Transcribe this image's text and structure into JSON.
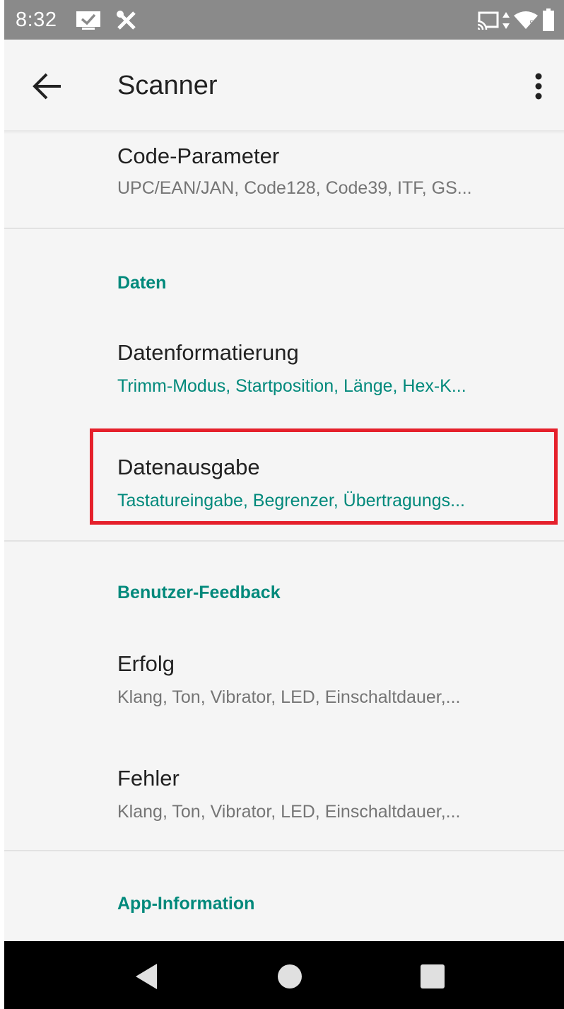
{
  "status_bar": {
    "time": "8:32",
    "left_icons": [
      "checkbox-screen-icon",
      "tools-icon"
    ],
    "right_icons": [
      "cast-icon",
      "data-arrows-icon",
      "wifi-icon",
      "battery-icon"
    ]
  },
  "app_bar": {
    "title": "Scanner",
    "back_icon": "arrow-back-icon",
    "menu_icon": "more-vert-icon"
  },
  "list": {
    "code_params": {
      "title": "Code-Parameter",
      "summary": "UPC/EAN/JAN, Code128, Code39, ITF, GS..."
    },
    "data_header": "Daten",
    "data_formatting": {
      "title": "Datenformatierung",
      "summary": "Trimm-Modus, Startposition, Länge, Hex-K..."
    },
    "data_output": {
      "title": "Datenausgabe",
      "summary": "Tastatureingabe, Begrenzer, Übertragungs..."
    },
    "feedback_header": "Benutzer-Feedback",
    "success": {
      "title": "Erfolg",
      "summary": "Klang, Ton, Vibrator, LED, Einschaltdauer,..."
    },
    "error": {
      "title": "Fehler",
      "summary": "Klang, Ton, Vibrator, LED, Einschaltdauer,..."
    },
    "app_info_header": "App-Information"
  },
  "nav_bar": {
    "icons": [
      "nav-back-icon",
      "nav-home-icon",
      "nav-recents-icon"
    ]
  },
  "colors": {
    "accent": "#00897b",
    "highlight": "#e5202b",
    "status_bar": "#8a8a8a",
    "background": "#f5f5f5"
  }
}
